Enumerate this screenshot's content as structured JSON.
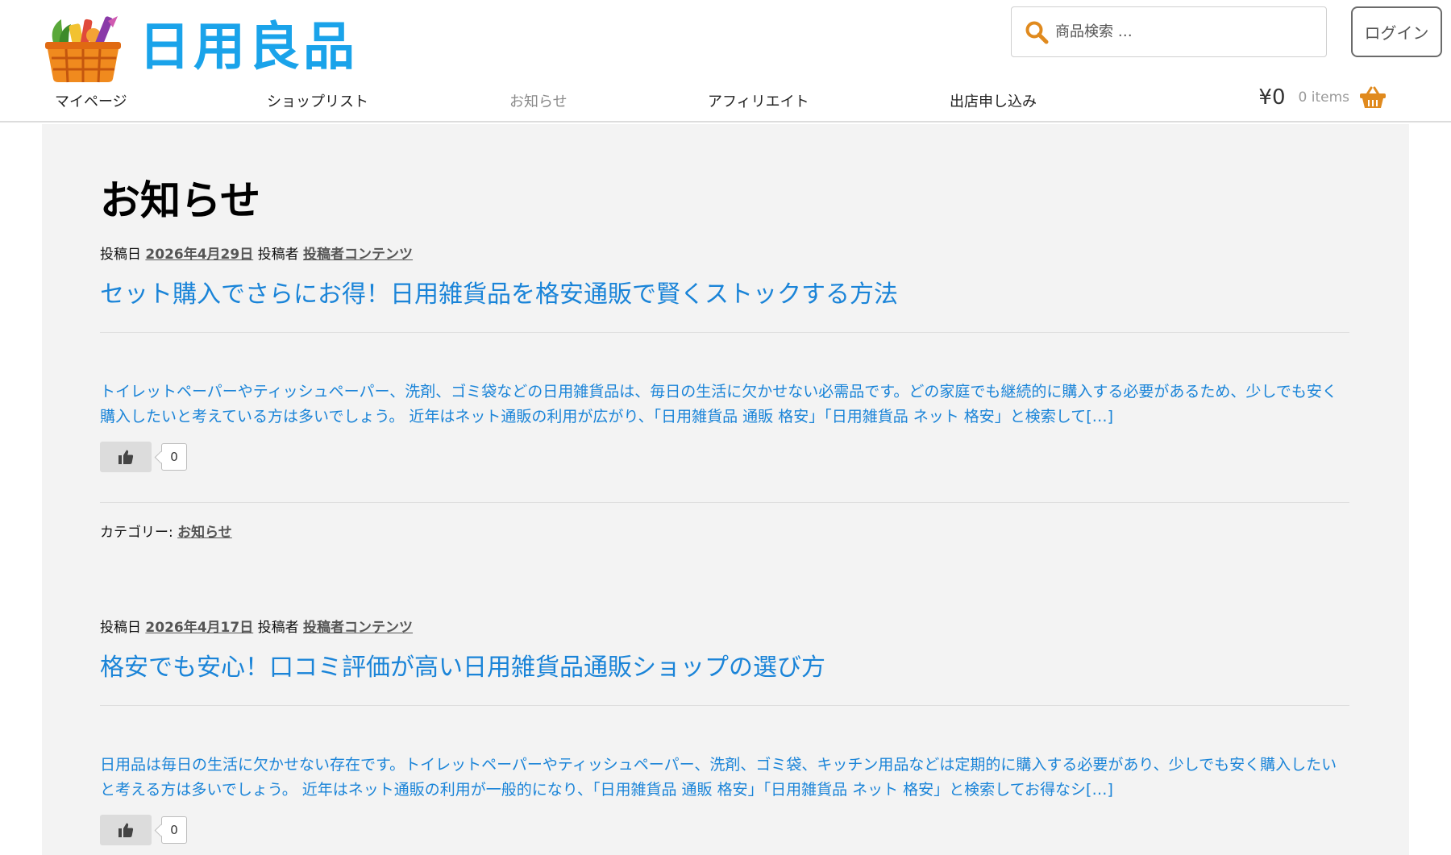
{
  "site": {
    "logo_text": "日用良品"
  },
  "search": {
    "placeholder": "商品検索 …"
  },
  "header": {
    "login_label": "ログイン"
  },
  "nav": {
    "items": [
      {
        "label": "マイページ"
      },
      {
        "label": "ショップリスト"
      },
      {
        "label": "お知らせ"
      },
      {
        "label": "アフィリエイト"
      },
      {
        "label": "出店申し込み"
      }
    ]
  },
  "cart": {
    "total": "¥0",
    "count_label": "0 items"
  },
  "page": {
    "title": "お知らせ"
  },
  "posts": [
    {
      "posted_label": "投稿日",
      "date": "2026年4月29日",
      "author_label": "投稿者",
      "author": "投稿者コンテンツ",
      "title": "セット購入でさらにお得！日用雑貨品を格安通販で賢くストックする方法",
      "excerpt": "トイレットペーパーやティッシュペーパー、洗剤、ゴミ袋などの日用雑貨品は、毎日の生活に欠かせない必需品です。どの家庭でも継続的に購入する必要があるため、少しでも安く購入したいと考えている方は多いでしょう。 近年はネット通販の利用が広がり、「日用雑貨品 通販 格安」「日用雑貨品 ネット 格安」と検索して",
      "more": "[…]",
      "likes": "0",
      "category_label": "カテゴリー:",
      "category": "お知らせ"
    },
    {
      "posted_label": "投稿日",
      "date": "2026年4月17日",
      "author_label": "投稿者",
      "author": "投稿者コンテンツ",
      "title": "格安でも安心！口コミ評価が高い日用雑貨品通販ショップの選び方",
      "excerpt": "日用品は毎日の生活に欠かせない存在です。トイレットペーパーやティッシュペーパー、洗剤、ゴミ袋、キッチン用品などは定期的に購入する必要があり、少しでも安く購入したいと考える方は多いでしょう。 近年はネット通販の利用が一般的になり、「日用雑貨品 通販 格安」「日用雑貨品 ネット 格安」と検索してお得なシ",
      "more": "[…]",
      "likes": "0"
    }
  ],
  "colors": {
    "brand": "#1aa3ea",
    "link": "#1a84d8",
    "accent": "#e08a1e",
    "content_bg": "#f3f3f3"
  },
  "icons": {
    "logo": "basket-logo-icon",
    "search": "search-icon",
    "cart": "basket-icon",
    "like": "thumbs-up-icon"
  }
}
